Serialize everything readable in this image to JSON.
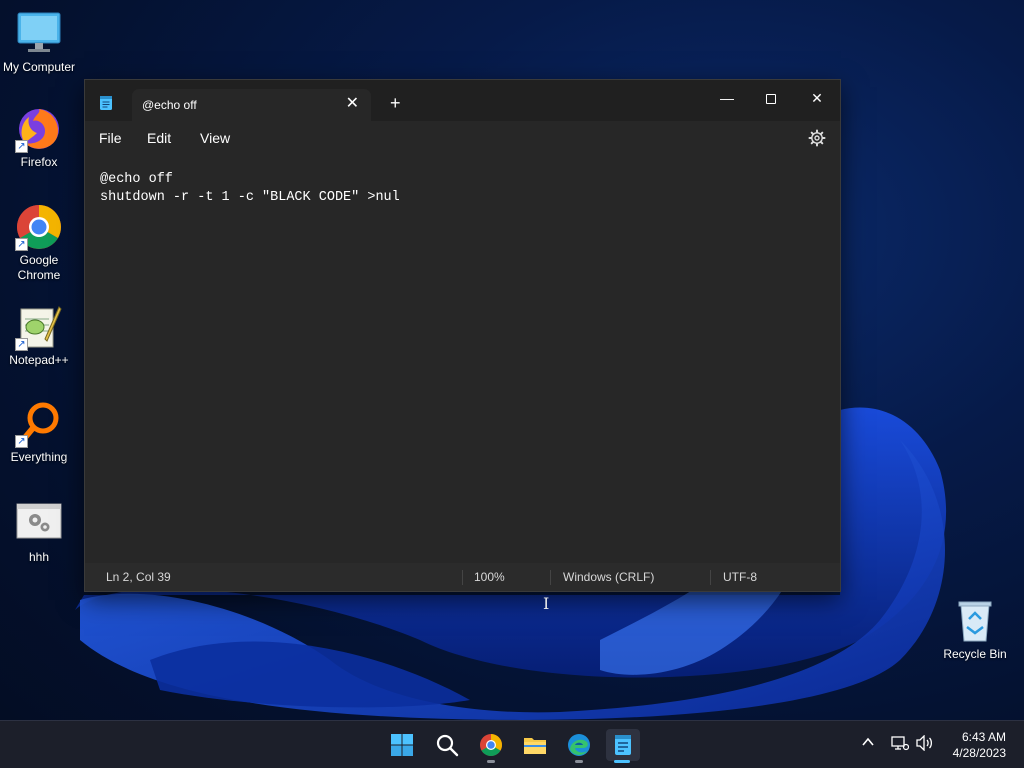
{
  "desktop": {
    "icons": [
      {
        "label": "My Computer"
      },
      {
        "label": "Firefox"
      },
      {
        "label": "Google Chrome"
      },
      {
        "label": "Notepad++"
      },
      {
        "label": "Everything"
      },
      {
        "label": "hhh"
      },
      {
        "label": "Recycle Bin"
      }
    ]
  },
  "notepad": {
    "tab_title": "@echo off",
    "menu": [
      "File",
      "Edit",
      "View"
    ],
    "content_lines": [
      "@echo off",
      "shutdown -r -t 1 -c \"BLACK CODE\" >nul"
    ],
    "status": {
      "position": "Ln 2, Col 39",
      "zoom": "100%",
      "line_ending": "Windows (CRLF)",
      "encoding": "UTF-8"
    }
  },
  "taskbar": {
    "apps": [
      "start-icon",
      "search-icon",
      "chrome-icon",
      "file-explorer-icon",
      "edge-icon",
      "notepad-icon"
    ],
    "clock": {
      "time": "6:43 AM",
      "date": "4/28/2023"
    }
  },
  "colors": {
    "accent": "#4cc2ff",
    "window_bg": "#272727",
    "titlebar_bg": "#202020"
  }
}
